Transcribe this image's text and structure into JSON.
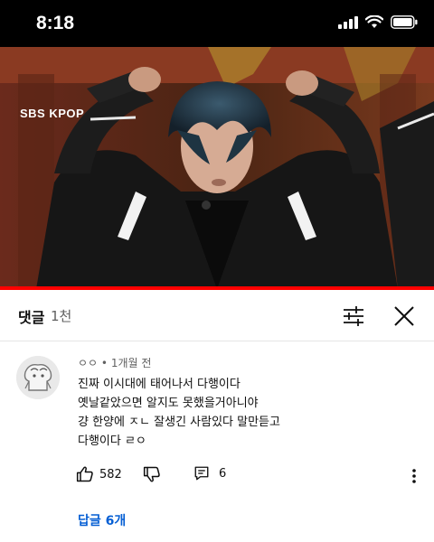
{
  "status_bar": {
    "time": "8:18",
    "icons": [
      "cellular-signal-icon",
      "wifi-icon",
      "battery-icon"
    ]
  },
  "video": {
    "channel_logo_text": "SBS KPOP",
    "progress": 1.0,
    "colors": {
      "progress": "#ff0000",
      "track": "#dcdcdc"
    }
  },
  "comments_header": {
    "title": "댓글",
    "count": "1천",
    "icons": [
      "filter-sliders-icon",
      "close-icon"
    ]
  },
  "comment": {
    "author": "ㅇㅇ",
    "separator": "•",
    "time": "1개월 전",
    "lines": [
      "진짜 이시대에  태어나서 다행이다",
      "옛날같았으면 알지도 못했을거아니야",
      "걍 한양에 ㅈㄴ 잘생긴 사람있다 말만듣고",
      "다행이다 ㄹㅇ"
    ],
    "likes": "582",
    "replies_count": "6",
    "replies_link": "답글 6개",
    "icons": [
      "thumbs-up-icon",
      "thumbs-down-icon",
      "reply-icon",
      "more-vert-icon"
    ],
    "colors": {
      "link": "#065fd4",
      "meta": "#606060"
    }
  }
}
